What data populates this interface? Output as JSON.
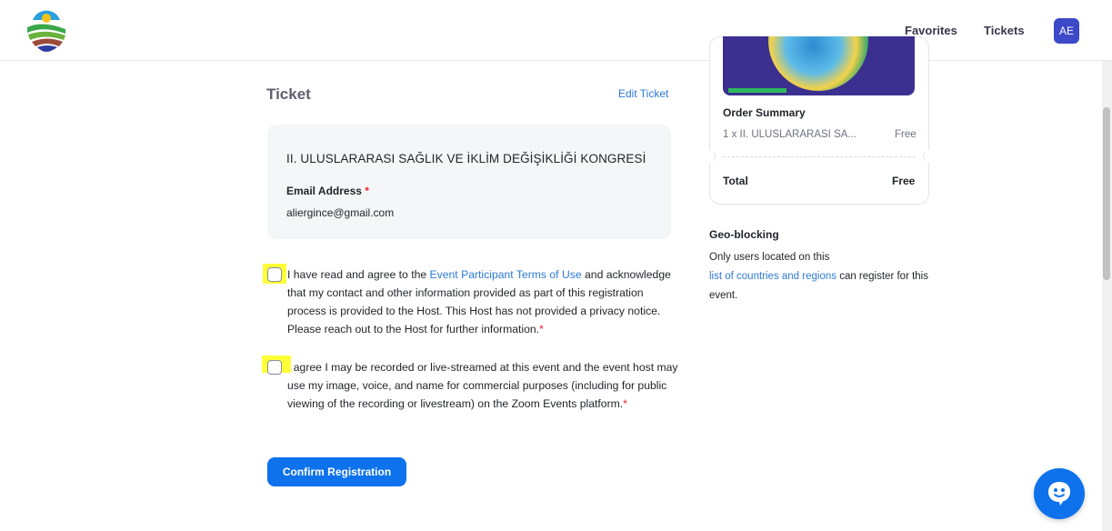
{
  "header": {
    "logo_icon": "congress-logo-icon",
    "nav": {
      "favorites": "Favorites",
      "tickets": "Tickets"
    },
    "avatar_initials": "AE"
  },
  "ticket": {
    "title": "Ticket",
    "edit_label": "Edit Ticket",
    "event_name": "II. ULUSLARARASI SAĞLIK VE İKLİM DEĞİŞİKLİĞİ KONGRESİ",
    "email_label": "Email Address",
    "required_mark": "*",
    "email_value": "aliergince@gmail.com"
  },
  "consents": [
    {
      "checked": false,
      "text_before": "I have read and agree to the ",
      "link_text": "Event Participant Terms of Use",
      "text_after": " and acknowledge that my contact and other information provided as part of this registration process is provided to the Host. This Host has not provided a privacy notice. Please reach out to the Host for further information.",
      "required_mark": "*"
    },
    {
      "checked": false,
      "text": "I agree I may be recorded or live-streamed at this event and the event host may use my image, voice, and name for commercial purposes (including for public viewing of the recording or livestream) on the Zoom Events platform.",
      "required_mark": "*"
    }
  ],
  "confirm_button": "Confirm Registration",
  "order_summary": {
    "title": "Order Summary",
    "item": "1 x II. ULUSLARARASI SA...",
    "item_price": "Free",
    "total_label": "Total",
    "total_value": "Free"
  },
  "geo_blocking": {
    "title": "Geo-blocking",
    "text_before": "Only users located on this ",
    "link_text": "list of countries and regions",
    "text_after": " can register for this event."
  },
  "chat": {
    "icon": "chat-bot-icon"
  },
  "colors": {
    "primary": "#0e72ed",
    "link": "#2d7ad6",
    "avatar": "#3c49c8",
    "highlight": "#ffff38",
    "required": "#e02828"
  }
}
